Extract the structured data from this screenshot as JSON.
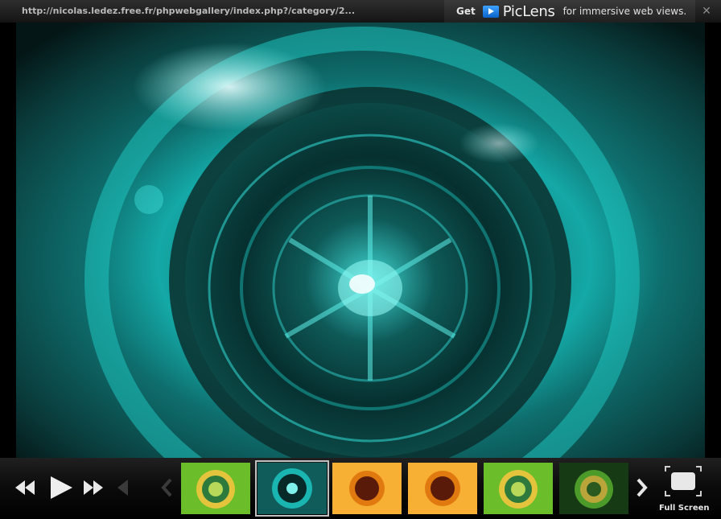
{
  "window": {
    "url": "http://nicolas.ledez.free.fr/phpwebgallery/index.php?/category/2...",
    "close_glyph": "✕"
  },
  "promo": {
    "get_label": "Get",
    "brand": "PicLens",
    "tagline": "for immersive web views.",
    "logo_icon": "play-badge-icon"
  },
  "viewer": {
    "image_description_icon": "teal-glass-bottle-photo"
  },
  "controls": {
    "rewind_icon": "rewind-icon",
    "play_icon": "play-icon",
    "fast_forward_icon": "fast-forward-icon",
    "prev_icon": "chevron-left-icon",
    "next_icon": "chevron-right-icon",
    "fullscreen_label": "Full Screen",
    "thumbnails": [
      {
        "theme": "green-yellow",
        "selected": false
      },
      {
        "theme": "teal",
        "selected": true
      },
      {
        "theme": "orange",
        "selected": false
      },
      {
        "theme": "orange",
        "selected": false
      },
      {
        "theme": "green-yellow",
        "selected": false
      },
      {
        "theme": "dark-green",
        "selected": false
      }
    ]
  },
  "colors": {
    "accent_teal": "#19c6c3",
    "thumb_green": "#7dc72a",
    "thumb_orange": "#f5a51c",
    "selected_border": "#bfbfbf"
  }
}
